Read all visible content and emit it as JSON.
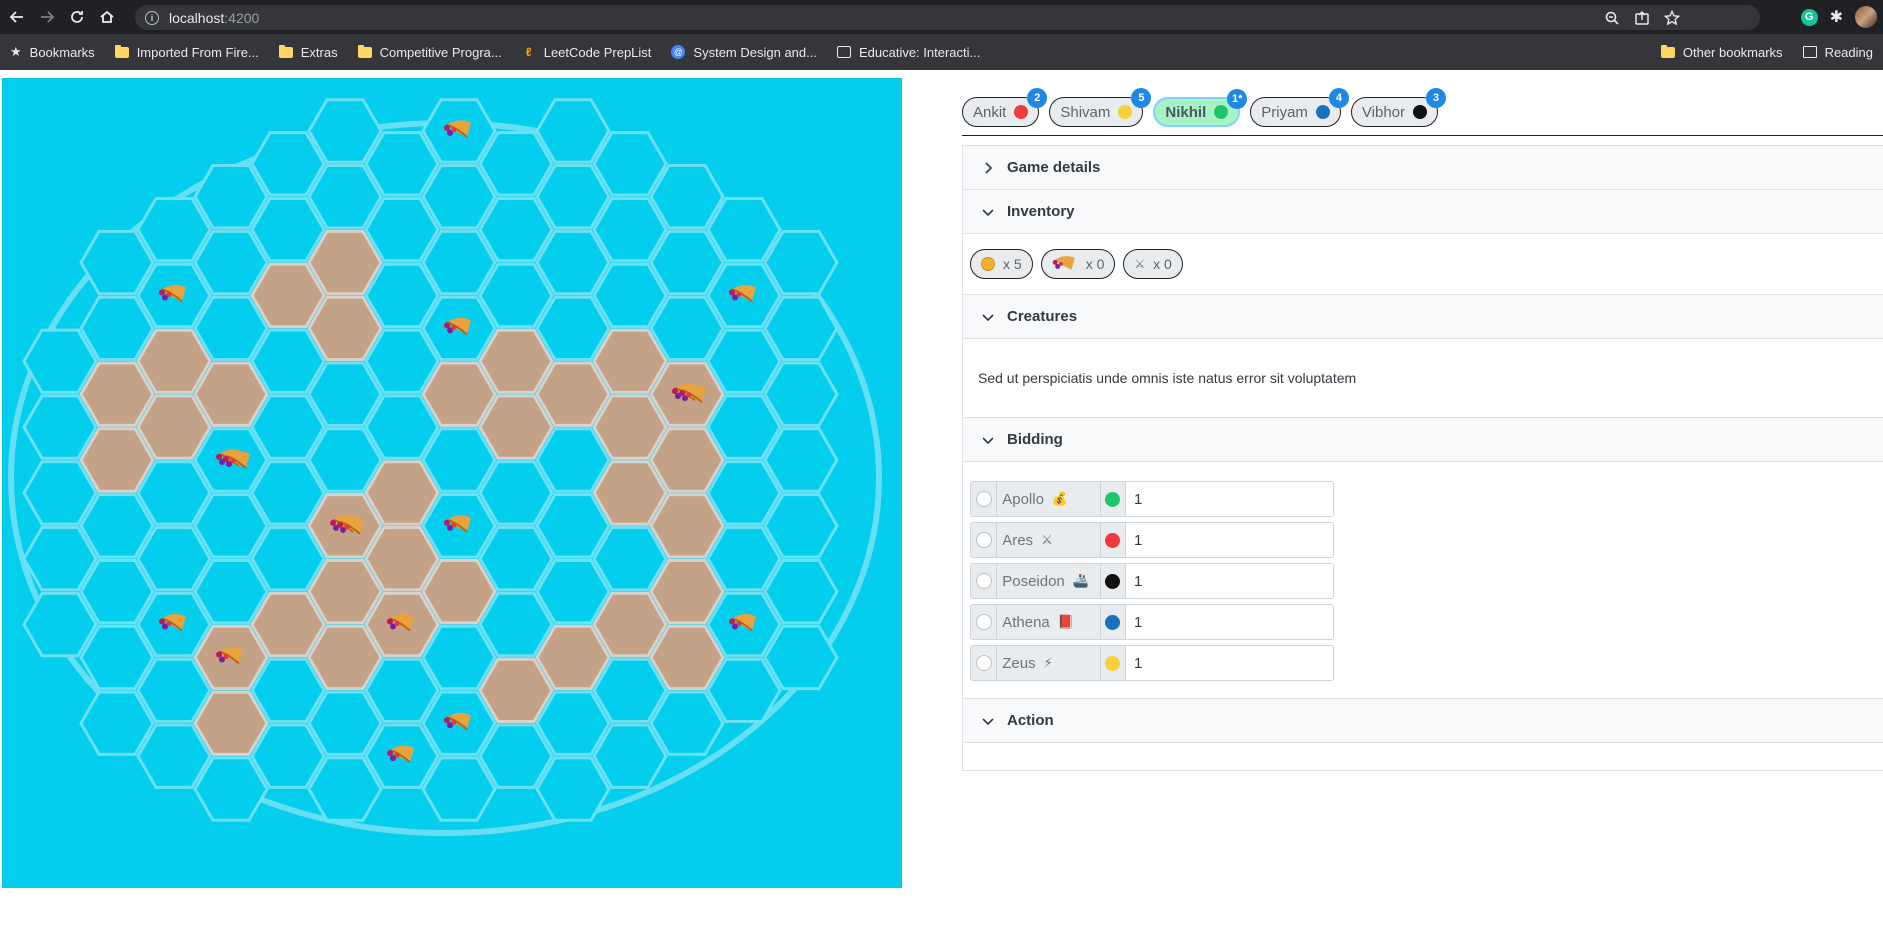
{
  "browser": {
    "url_host": "localhost",
    "url_port": ":4200",
    "bookmarks": [
      {
        "label": "Bookmarks",
        "icon": "star-icon"
      },
      {
        "label": "Imported From Fire...",
        "icon": "folder-icon"
      },
      {
        "label": "Extras",
        "icon": "folder-icon"
      },
      {
        "label": "Competitive Progra...",
        "icon": "folder-icon"
      },
      {
        "label": "LeetCode PrepList",
        "icon": "leetcode-icon"
      },
      {
        "label": "System Design and...",
        "icon": "globe-icon"
      },
      {
        "label": "Educative: Interacti...",
        "icon": "educative-icon"
      }
    ],
    "bookmarks_right": [
      {
        "label": "Other bookmarks",
        "icon": "folder-icon"
      },
      {
        "label": "Reading",
        "icon": "reading-list-icon"
      }
    ]
  },
  "players": [
    {
      "name": "Ankit",
      "color": "#ef3b3b",
      "badge": "2",
      "active": false
    },
    {
      "name": "Shivam",
      "color": "#f7d03c",
      "badge": "5",
      "active": false
    },
    {
      "name": "Nikhil",
      "color": "#1fc46b",
      "badge": "1*",
      "active": true
    },
    {
      "name": "Priyam",
      "color": "#1b6fbf",
      "badge": "4",
      "active": false
    },
    {
      "name": "Vibhor",
      "color": "#111111",
      "badge": "3",
      "active": false
    }
  ],
  "sections": {
    "game_details": "Game details",
    "inventory": "Inventory",
    "creatures": "Creatures",
    "bidding": "Bidding",
    "action": "Action"
  },
  "inventory": [
    {
      "icon": "coin-icon",
      "count": "x 5"
    },
    {
      "icon": "cornucopia-icon",
      "count": "x 0"
    },
    {
      "icon": "warrior-icon",
      "count": "x 0"
    }
  ],
  "creatures_text": "Sed ut perspiciatis unde omnis iste natus error sit voluptatem",
  "bids": [
    {
      "god": "Apollo",
      "icon": "money-bag-icon",
      "glyph": "💰",
      "color": "#1fc46b",
      "value": "1"
    },
    {
      "god": "Ares",
      "icon": "warrior-icon",
      "glyph": "⚔",
      "color": "#ef3b3b",
      "value": "1"
    },
    {
      "god": "Poseidon",
      "icon": "ship-icon",
      "glyph": "🚢",
      "color": "#111111",
      "value": "1"
    },
    {
      "god": "Athena",
      "icon": "book-icon",
      "glyph": "📕",
      "color": "#1b6fbf",
      "value": "1"
    },
    {
      "god": "Zeus",
      "icon": "lightning-icon",
      "glyph": "⚡",
      "color": "#f7d03c",
      "value": "1"
    }
  ],
  "board": {
    "water_color": "#04ceed",
    "land_color": "#c4a287",
    "land_hexes": [
      [
        5,
        2
      ],
      [
        4,
        3
      ],
      [
        5,
        3
      ],
      [
        1,
        4
      ],
      [
        2,
        4
      ],
      [
        3,
        4
      ],
      [
        7,
        4
      ],
      [
        8,
        4
      ],
      [
        9,
        4
      ],
      [
        10,
        4
      ],
      [
        11,
        4
      ],
      [
        1,
        5
      ],
      [
        2,
        5
      ],
      [
        8,
        5
      ],
      [
        10,
        5
      ],
      [
        11,
        5
      ],
      [
        5,
        6
      ],
      [
        6,
        6
      ],
      [
        10,
        6
      ],
      [
        11,
        6
      ],
      [
        5,
        7
      ],
      [
        6,
        7
      ],
      [
        7,
        7
      ],
      [
        11,
        7
      ],
      [
        3,
        8
      ],
      [
        4,
        8
      ],
      [
        5,
        8
      ],
      [
        6,
        8
      ],
      [
        9,
        8
      ],
      [
        10,
        8
      ],
      [
        11,
        8
      ],
      [
        3,
        9
      ],
      [
        8,
        9
      ]
    ],
    "cornucopias": [
      [
        7,
        0
      ],
      [
        2,
        3
      ],
      [
        12,
        3
      ],
      [
        7,
        3
      ],
      [
        11,
        4
      ],
      [
        3,
        5
      ],
      [
        5,
        6
      ],
      [
        7,
        6
      ],
      [
        6,
        8
      ],
      [
        2,
        8
      ],
      [
        3,
        8
      ],
      [
        12,
        8
      ],
      [
        7,
        9
      ],
      [
        6,
        10
      ]
    ],
    "double_cornucopias": [
      [
        11,
        4
      ],
      [
        3,
        5
      ],
      [
        5,
        6
      ]
    ]
  }
}
